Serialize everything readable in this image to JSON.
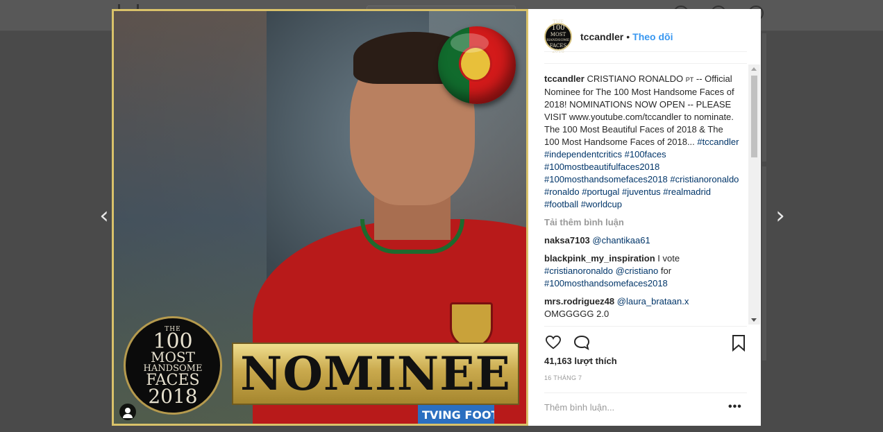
{
  "post": {
    "username": "tccandler",
    "separator": "•",
    "follow_label": "Theo dõi",
    "avatar_text": [
      "THE",
      "100",
      "MOST",
      "HANDSOME",
      "FACES",
      "2018"
    ]
  },
  "image": {
    "badge": {
      "the": "THE",
      "num": "100",
      "most": "MOST",
      "handsome": "HANDSOME",
      "faces": "FACES",
      "year": "2018"
    },
    "nominee": "NOMINEE",
    "armband": "TVING FOOTBALL"
  },
  "caption": {
    "username": "tccandler",
    "text_before_pt": "CRISTIANO RONALDO",
    "pt": "PT",
    "text_after_pt": "-- Official Nominee for The 100 Most Handsome Faces of 2018! NOMINATIONS NOW OPEN -- PLEASE VISIT www.youtube.com/tccandler to nominate. The 100 Most Beautiful Faces of 2018 & The 100 Most Handsome Faces of 2018...",
    "hashtags": "#tccandler #independentcritics #100faces #100mostbeautifulfaces2018 #100mosthandsomefaces2018 #cristianoronaldo #ronaldo #portugal #juventus #realmadrid #football #worldcup"
  },
  "load_more_label": "Tải thêm bình luận",
  "comments": [
    {
      "user": "naksa7103",
      "mention": "@chantikaa61",
      "text": ""
    },
    {
      "user": "blackpink_my_inspiration",
      "text_pre": "I vote",
      "mention1": "#cristianoronaldo",
      "mention2": "@cristiano",
      "text_mid": "for",
      "mention3": "#100mosthandsomefaces2018"
    },
    {
      "user": "mrs.rodriguez48",
      "mention": "@laura_brataan.x",
      "text": "OMGGGGG 2.0"
    }
  ],
  "likes_label": "41,163 lượt thích",
  "date_label": "16 THÁNG 7",
  "add_comment_placeholder": "Thêm bình luận...",
  "more_label": "•••",
  "nav": {
    "prev": "‹",
    "next": "›"
  }
}
